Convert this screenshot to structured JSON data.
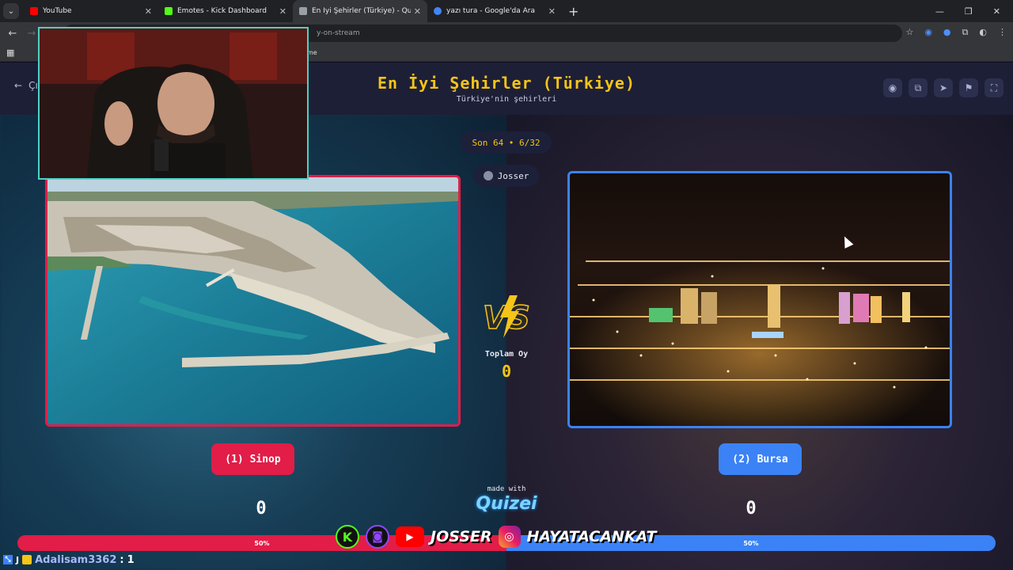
{
  "browser": {
    "tabs": [
      {
        "title": "YouTube",
        "fav_color": "#ff0000",
        "active": false
      },
      {
        "title": "Emotes - Kick Dashboard",
        "fav_color": "#53fc18",
        "active": false
      },
      {
        "title": "En İyi Şehirler (Türkiye) - Quizei",
        "fav_color": "#9aa0a6",
        "active": true
      },
      {
        "title": "yazı tura - Google'da Ara",
        "fav_color": "#4285f4",
        "active": false
      }
    ],
    "url": "y-on-stream",
    "bookmark_text": "me"
  },
  "header": {
    "back_label": "Çı",
    "title": "En İyi Şehirler (Türkiye)",
    "subtitle": "Türkiye'nin şehirleri"
  },
  "game": {
    "round": "Son 64 • 6/32",
    "user": "Josser",
    "total_votes_label": "Toplam Oy",
    "total_votes": "0",
    "option_left": "(1) Sinop",
    "option_right": "(2) Bursa",
    "count_left": "0",
    "count_right": "0",
    "percent_left_label": "50%",
    "percent_right_label": "50%",
    "percent_left": 50,
    "percent_right": 50,
    "vs_text": "VS"
  },
  "footer": {
    "made_with": "made with",
    "brand": "Quizei"
  },
  "overlay": {
    "socials_name": "JOSSER",
    "instagram_name": "HAYATACANKAT",
    "chat_user": "Adalisam3362",
    "chat_sep": ":",
    "chat_msg": "1",
    "badge_letter": "J"
  },
  "colors": {
    "accent_gold": "#f5c518",
    "left_red": "#e11d48",
    "right_blue": "#3b82f6"
  }
}
